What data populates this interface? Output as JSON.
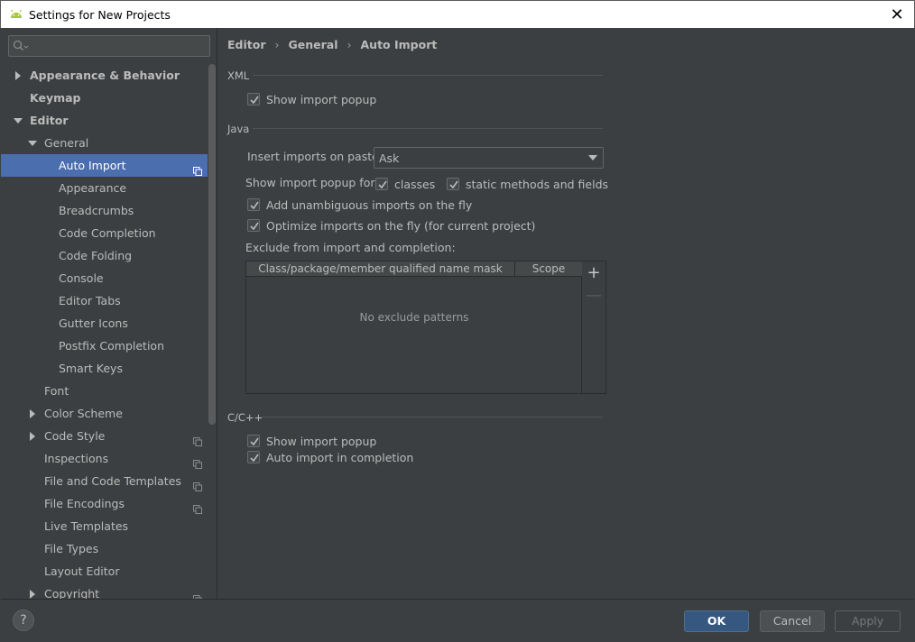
{
  "window": {
    "title": "Settings for New Projects",
    "close_label": "✕"
  },
  "search": {
    "placeholder": ""
  },
  "tree": [
    {
      "label": "Appearance & Behavior",
      "level": 0,
      "arrow": "right",
      "bold": true
    },
    {
      "label": "Keymap",
      "level": 0,
      "arrow": "",
      "bold": true
    },
    {
      "label": "Editor",
      "level": 0,
      "arrow": "down",
      "bold": true
    },
    {
      "label": "General",
      "level": 1,
      "arrow": "down"
    },
    {
      "label": "Auto Import",
      "level": 2,
      "selected": true,
      "copy": true
    },
    {
      "label": "Appearance",
      "level": 2
    },
    {
      "label": "Breadcrumbs",
      "level": 2
    },
    {
      "label": "Code Completion",
      "level": 2
    },
    {
      "label": "Code Folding",
      "level": 2
    },
    {
      "label": "Console",
      "level": 2
    },
    {
      "label": "Editor Tabs",
      "level": 2
    },
    {
      "label": "Gutter Icons",
      "level": 2
    },
    {
      "label": "Postfix Completion",
      "level": 2
    },
    {
      "label": "Smart Keys",
      "level": 2
    },
    {
      "label": "Font",
      "level": 1
    },
    {
      "label": "Color Scheme",
      "level": 1,
      "arrow": "right"
    },
    {
      "label": "Code Style",
      "level": 1,
      "arrow": "right",
      "copy": true
    },
    {
      "label": "Inspections",
      "level": 1,
      "copy": true
    },
    {
      "label": "File and Code Templates",
      "level": 1,
      "copy": true
    },
    {
      "label": "File Encodings",
      "level": 1,
      "copy": true
    },
    {
      "label": "Live Templates",
      "level": 1
    },
    {
      "label": "File Types",
      "level": 1
    },
    {
      "label": "Layout Editor",
      "level": 1
    },
    {
      "label": "Copyright",
      "level": 1,
      "arrow": "right",
      "copy": true
    }
  ],
  "breadcrumb": {
    "items": [
      "Editor",
      "General",
      "Auto Import"
    ],
    "separator": "›"
  },
  "xml": {
    "title": "XML",
    "show_import_popup": {
      "label": "Show import popup",
      "checked": true
    }
  },
  "java": {
    "title": "Java",
    "insert_imports_label": "Insert imports on paste:",
    "insert_imports_value": "Ask",
    "show_popup_for_label": "Show import popup for:",
    "classes": {
      "label": "classes",
      "checked": true
    },
    "static_methods": {
      "label": "static methods and fields",
      "checked": true
    },
    "add_unambiguous": {
      "label": "Add unambiguous imports on the fly",
      "checked": true
    },
    "optimize": {
      "label": "Optimize imports on the fly (for current project)",
      "checked": true
    },
    "exclude_label": "Exclude from import and completion:",
    "table": {
      "columns": [
        "Class/package/member qualified name mask",
        "Scope"
      ],
      "empty_text": "No exclude patterns",
      "add_label": "+",
      "remove_label": "—"
    }
  },
  "cpp": {
    "title": "C/C++",
    "show_import_popup": {
      "label": "Show import popup",
      "checked": true
    },
    "auto_import": {
      "label": "Auto import in completion",
      "checked": true
    }
  },
  "footer": {
    "help_label": "?",
    "ok_label": "OK",
    "cancel_label": "Cancel",
    "apply_label": "Apply"
  },
  "colors": {
    "accent": "#4b6eaf",
    "ok_button": "#365880",
    "background": "#3c3f41"
  }
}
